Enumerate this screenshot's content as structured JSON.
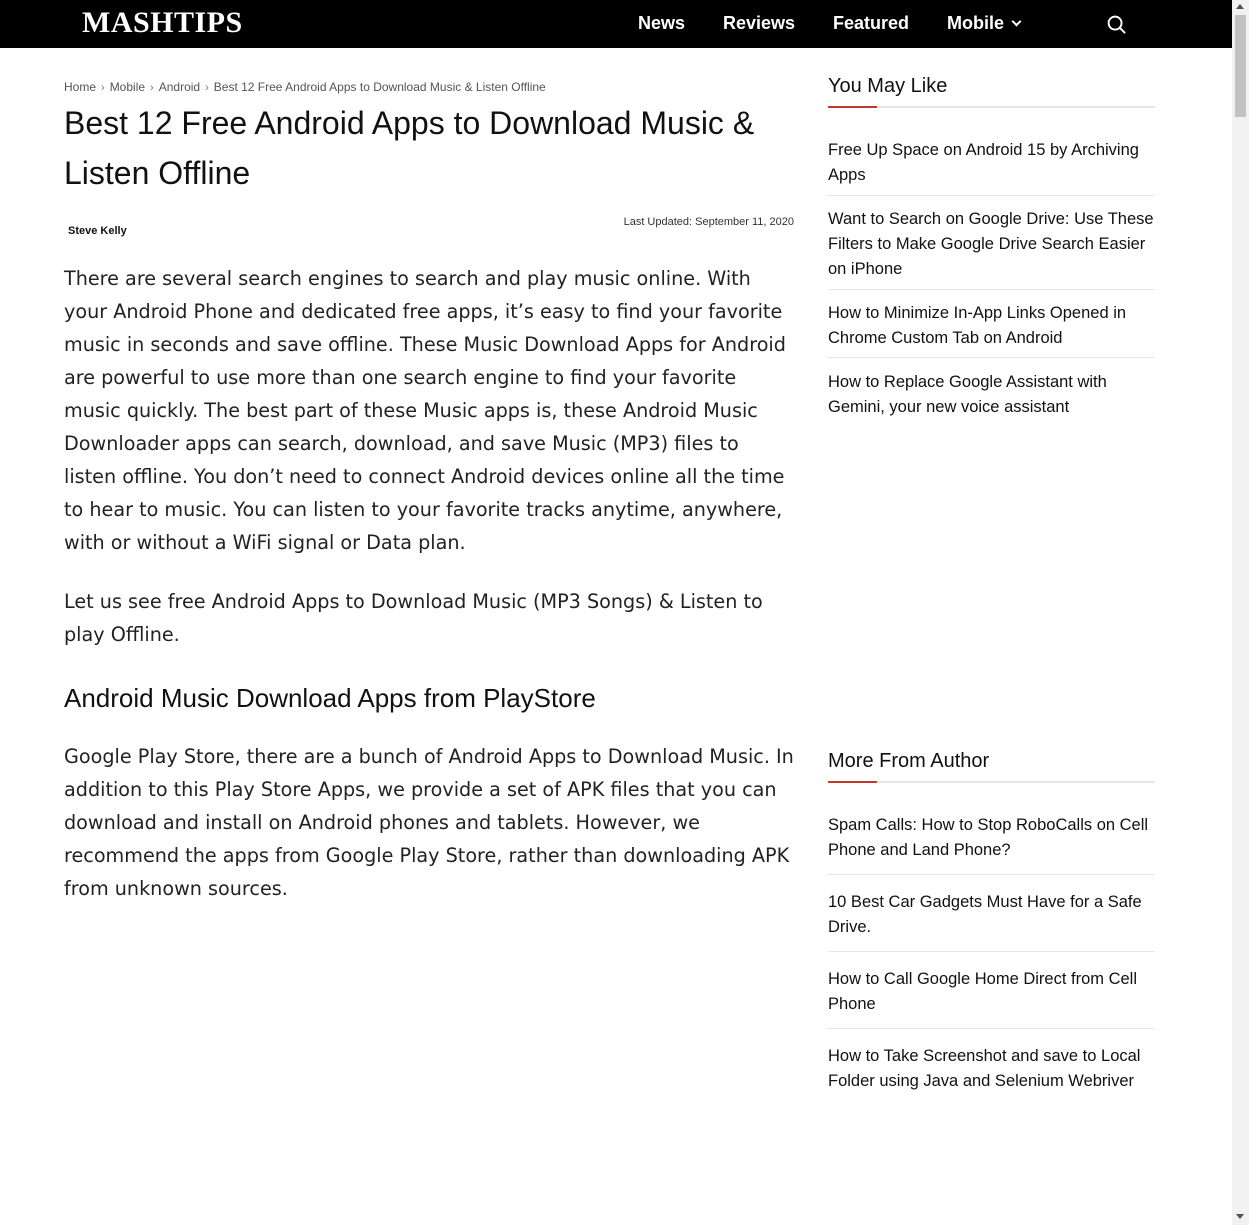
{
  "header": {
    "logo": "MASHTIPS",
    "nav": [
      "News",
      "Reviews",
      "Featured",
      "Mobile"
    ]
  },
  "breadcrumb": [
    "Home",
    "Mobile",
    "Android",
    "Best 12 Free Android Apps to Download Music & Listen Offline"
  ],
  "article": {
    "title": "Best 12 Free Android Apps to Download Music & Listen Offline",
    "author": "Steve Kelly",
    "updated": "Last Updated: September 11, 2020",
    "p1": "There are several search engines to search and play music online. With your Android Phone and dedicated free apps, it’s easy to find your favorite music in seconds and save offline. These Music Download Apps for Android are powerful to use more than one search engine to find your favorite music quickly. The best part of these Music apps is, these Android Music Downloader apps can search, download, and save Music (MP3) files to listen offline. You don’t need to connect Android devices online all the time to hear to music. You can listen to your favorite tracks anytime, anywhere, with or without a WiFi signal or Data plan.",
    "p2": "Let us see free Android Apps to Download Music (MP3 Songs) & Listen to play Offline.",
    "h2": "Android Music Download Apps from PlayStore",
    "p3": "Google Play Store, there are a bunch of Android Apps to Download Music. In addition to this Play Store Apps, we provide a set of APK files that you can download and install on Android phones and tablets. However, we recommend the apps from Google Play Store, rather than downloading APK from unknown sources."
  },
  "sidebar": {
    "you_may_like": {
      "heading": "You May Like",
      "items": [
        "Free Up Space on Android 15 by Archiving Apps",
        "Want to Search on Google Drive: Use These Filters to Make Google Drive Search Easier on iPhone",
        "How to Minimize In-App Links Opened in Chrome Custom Tab on Android",
        "How to Replace Google Assistant with Gemini, your new voice assistant"
      ]
    },
    "more_from_author": {
      "heading": "More From Author",
      "items": [
        "Spam Calls: How to Stop RoboCalls on Cell Phone and Land Phone?",
        "10 Best Car Gadgets Must Have for a Safe Drive.",
        "How to Call Google Home Direct from Cell Phone",
        "How to Take Screenshot and save to Local Folder using Java and Selenium Webriver"
      ]
    }
  },
  "colors": {
    "header_bg": "#000000",
    "accent": "#c0392b"
  },
  "icons": [
    "search-icon",
    "chevron-down-icon"
  ]
}
